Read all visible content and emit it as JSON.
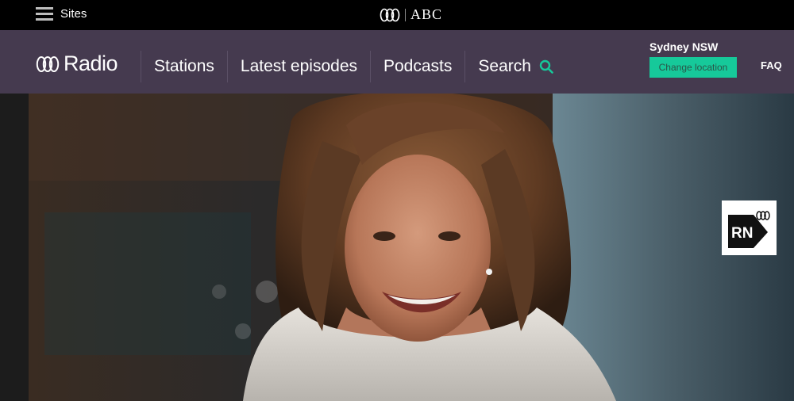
{
  "topbar": {
    "sites_label": "Sites",
    "abc_logo_text": "ABC"
  },
  "nav": {
    "logo_text": "Radio",
    "links": [
      {
        "label": "Stations"
      },
      {
        "label": "Latest episodes"
      },
      {
        "label": "Podcasts"
      },
      {
        "label": "Search"
      }
    ],
    "location": {
      "name": "Sydney NSW",
      "change_label": "Change location"
    },
    "faq_label": "FAQ"
  },
  "hero": {
    "station_badge_text": "RN",
    "photo_description_icon": "woman-portrait-photo"
  },
  "colors": {
    "topbar_bg": "#000000",
    "nav_bg": "#453a4f",
    "accent": "#16c99a"
  }
}
